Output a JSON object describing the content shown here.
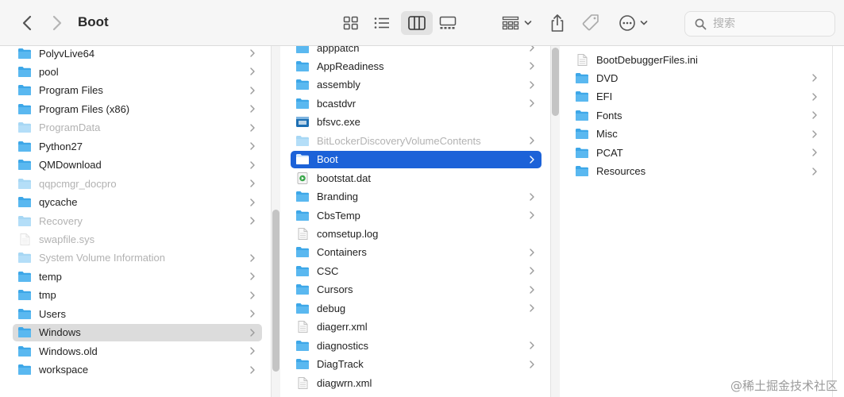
{
  "window": {
    "title": "Boot"
  },
  "search": {
    "placeholder": "搜索"
  },
  "colors": {
    "folder": "#3da7e8",
    "selection": "#1c62d8",
    "selection_inactive": "#dcdcdc"
  },
  "columns": [
    {
      "items": [
        {
          "name": "PolyvLive64",
          "kind": "folder",
          "dim": false,
          "arrow": true
        },
        {
          "name": "pool",
          "kind": "folder",
          "dim": false,
          "arrow": true
        },
        {
          "name": "Program Files",
          "kind": "folder",
          "dim": false,
          "arrow": true
        },
        {
          "name": "Program Files (x86)",
          "kind": "folder",
          "dim": false,
          "arrow": true
        },
        {
          "name": "ProgramData",
          "kind": "folder",
          "dim": true,
          "arrow": true
        },
        {
          "name": "Python27",
          "kind": "folder",
          "dim": false,
          "arrow": true
        },
        {
          "name": "QMDownload",
          "kind": "folder",
          "dim": false,
          "arrow": true
        },
        {
          "name": "qqpcmgr_docpro",
          "kind": "folder",
          "dim": true,
          "arrow": true
        },
        {
          "name": "qycache",
          "kind": "folder",
          "dim": false,
          "arrow": true
        },
        {
          "name": "Recovery",
          "kind": "folder",
          "dim": true,
          "arrow": true
        },
        {
          "name": "swapfile.sys",
          "kind": "file",
          "dim": true,
          "arrow": false
        },
        {
          "name": "System Volume Information",
          "kind": "folder",
          "dim": true,
          "arrow": true
        },
        {
          "name": "temp",
          "kind": "folder",
          "dim": false,
          "arrow": true
        },
        {
          "name": "tmp",
          "kind": "folder",
          "dim": false,
          "arrow": true
        },
        {
          "name": "Users",
          "kind": "folder",
          "dim": false,
          "arrow": true
        },
        {
          "name": "Windows",
          "kind": "folder",
          "dim": false,
          "arrow": true,
          "selected": "inactive"
        },
        {
          "name": "Windows.old",
          "kind": "folder",
          "dim": false,
          "arrow": true
        },
        {
          "name": "workspace",
          "kind": "folder",
          "dim": false,
          "arrow": true
        }
      ]
    },
    {
      "items": [
        {
          "name": "apppatch",
          "kind": "folder",
          "dim": false,
          "arrow": true
        },
        {
          "name": "AppReadiness",
          "kind": "folder",
          "dim": false,
          "arrow": true
        },
        {
          "name": "assembly",
          "kind": "folder",
          "dim": false,
          "arrow": true
        },
        {
          "name": "bcastdvr",
          "kind": "folder",
          "dim": false,
          "arrow": true
        },
        {
          "name": "bfsvc.exe",
          "kind": "exe",
          "dim": false,
          "arrow": false
        },
        {
          "name": "BitLockerDiscoveryVolumeContents",
          "kind": "folder",
          "dim": true,
          "arrow": true
        },
        {
          "name": "Boot",
          "kind": "folder",
          "dim": false,
          "arrow": true,
          "selected": "active"
        },
        {
          "name": "bootstat.dat",
          "kind": "dat",
          "dim": false,
          "arrow": false
        },
        {
          "name": "Branding",
          "kind": "folder",
          "dim": false,
          "arrow": true
        },
        {
          "name": "CbsTemp",
          "kind": "folder",
          "dim": false,
          "arrow": true
        },
        {
          "name": "comsetup.log",
          "kind": "file",
          "dim": false,
          "arrow": false
        },
        {
          "name": "Containers",
          "kind": "folder",
          "dim": false,
          "arrow": true
        },
        {
          "name": "CSC",
          "kind": "folder",
          "dim": false,
          "arrow": true
        },
        {
          "name": "Cursors",
          "kind": "folder",
          "dim": false,
          "arrow": true
        },
        {
          "name": "debug",
          "kind": "folder",
          "dim": false,
          "arrow": true
        },
        {
          "name": "diagerr.xml",
          "kind": "file",
          "dim": false,
          "arrow": false
        },
        {
          "name": "diagnostics",
          "kind": "folder",
          "dim": false,
          "arrow": true
        },
        {
          "name": "DiagTrack",
          "kind": "folder",
          "dim": false,
          "arrow": true
        },
        {
          "name": "diagwrn.xml",
          "kind": "file",
          "dim": false,
          "arrow": false
        }
      ]
    },
    {
      "items": [
        {
          "name": "BootDebuggerFiles.ini",
          "kind": "file",
          "dim": false,
          "arrow": false
        },
        {
          "name": "DVD",
          "kind": "folder",
          "dim": false,
          "arrow": true
        },
        {
          "name": "EFI",
          "kind": "folder",
          "dim": false,
          "arrow": true
        },
        {
          "name": "Fonts",
          "kind": "folder",
          "dim": false,
          "arrow": true
        },
        {
          "name": "Misc",
          "kind": "folder",
          "dim": false,
          "arrow": true
        },
        {
          "name": "PCAT",
          "kind": "folder",
          "dim": false,
          "arrow": true
        },
        {
          "name": "Resources",
          "kind": "folder",
          "dim": false,
          "arrow": true
        }
      ]
    }
  ],
  "watermark": "@稀土掘金技术社区"
}
